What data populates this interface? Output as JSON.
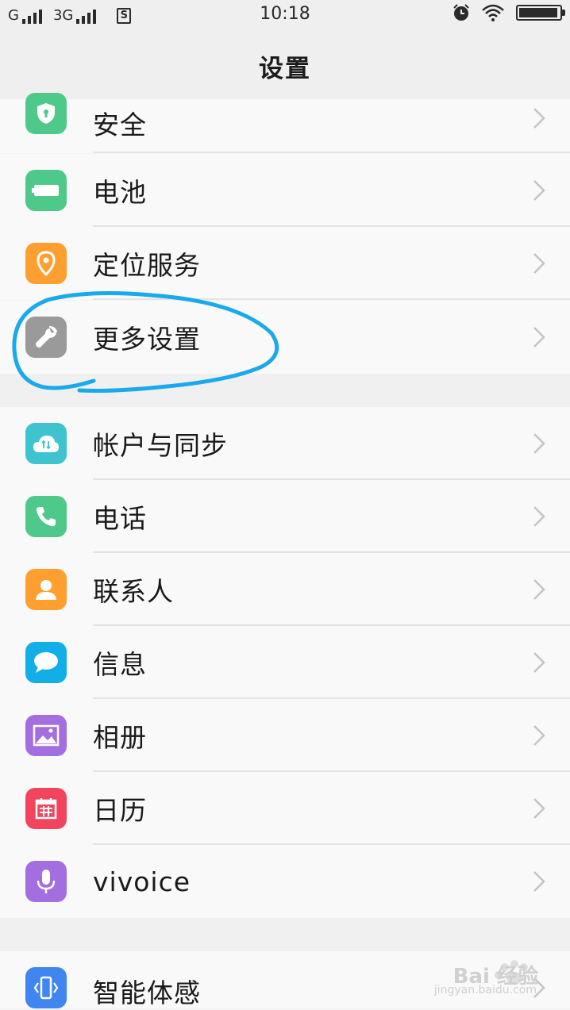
{
  "status_bar": {
    "carrier1": "G",
    "carrier2": "3G",
    "sim_badge": "S",
    "time": "10:18",
    "battery_level": 0.95
  },
  "header": {
    "title": "设置"
  },
  "groups": [
    {
      "items": [
        {
          "label": "安全",
          "icon": "shield-icon",
          "color": "#4fc98a"
        },
        {
          "label": "电池",
          "icon": "battery-icon",
          "color": "#4fc98a"
        },
        {
          "label": "定位服务",
          "icon": "location-pin-icon",
          "color": "#ff9f30"
        },
        {
          "label": "更多设置",
          "icon": "wrench-icon",
          "color": "#9a9a9a"
        }
      ]
    },
    {
      "items": [
        {
          "label": "帐户与同步",
          "icon": "cloud-sync-icon",
          "color": "#3ec3cf"
        },
        {
          "label": "电话",
          "icon": "phone-icon",
          "color": "#4fc98a"
        },
        {
          "label": "联系人",
          "icon": "contact-icon",
          "color": "#ff9f30"
        },
        {
          "label": "信息",
          "icon": "message-icon",
          "color": "#12aee8"
        },
        {
          "label": "相册",
          "icon": "gallery-icon",
          "color": "#a36ee0"
        },
        {
          "label": "日历",
          "icon": "calendar-icon",
          "color": "#f2455d"
        },
        {
          "label": "vivoice",
          "icon": "microphone-icon",
          "color": "#a36ee0"
        }
      ]
    },
    {
      "items": [
        {
          "label": "智能体感",
          "icon": "motion-phone-icon",
          "color": "#3f86f0"
        }
      ]
    }
  ],
  "annotation_color": "#1aa9ea",
  "watermark": {
    "text": "Bai 经验",
    "sub": "jingyan.baidu.com"
  }
}
